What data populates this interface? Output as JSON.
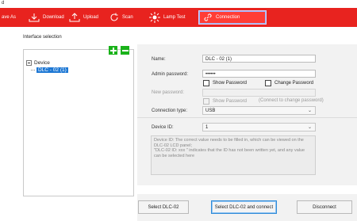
{
  "window": {
    "title_fragment": "d"
  },
  "toolbar": {
    "save_as": "ave As",
    "download": "Download",
    "upload": "Upload",
    "scan": "Scan",
    "lamp_test": "Lamp Test",
    "connection": "Connection",
    "color": "#e8231f"
  },
  "interface_panel": {
    "title": "Interface selection"
  },
  "tree": {
    "root": "Device",
    "child": "DLC - 02 (1)"
  },
  "form": {
    "name_label": "Name:",
    "name_value": "DLC - 02 (1)",
    "admin_password_label": "Admin password:",
    "admin_password_value": "••••••",
    "show_password": "Show Password",
    "change_password": "Change Password",
    "new_password_label": "New password:",
    "show_password2": "Show Password",
    "connect_hint": "(Connect to change password)",
    "connection_type_label": "Connection type:",
    "connection_type_value": "USB",
    "device_id_label": "Device ID:",
    "device_id_value": "1",
    "description": [
      "Device ID: The correct value needs to be filled in, which can be viewed on the",
      "DLC-02 LCD panel;",
      "\"DLC-02 ID: xxx \" indicates that the ID has not been written yet, and any value",
      "can be selected here"
    ]
  },
  "buttons": {
    "select": "Select DLC-02",
    "select_connect": "Select DLC-02 and connect",
    "disconnect": "Disconnect"
  }
}
